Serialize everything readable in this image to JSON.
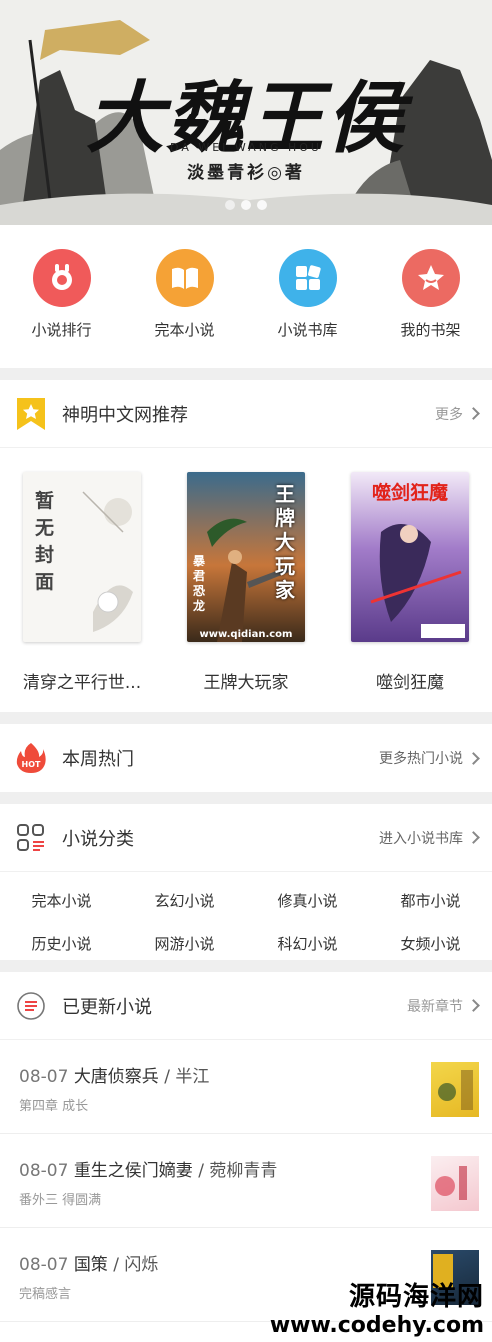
{
  "banner": {
    "title": "大魏王侯",
    "pinyin": "DA WEI WANG HOU",
    "author": "淡墨青衫◎著",
    "slides": 3,
    "active_slide": 1
  },
  "quicknav": [
    {
      "label": "小说排行",
      "icon": "ranking-icon",
      "color": "#f05a5a"
    },
    {
      "label": "完本小说",
      "icon": "book-open-icon",
      "color": "#f5a236"
    },
    {
      "label": "小说书库",
      "icon": "library-grid-icon",
      "color": "#3fb2ea"
    },
    {
      "label": "我的书架",
      "icon": "star-shelf-icon",
      "color": "#ec6a62"
    }
  ],
  "recommend": {
    "title": "神明中文网推荐",
    "more": "更多",
    "books": [
      {
        "title": "清穿之平行世...",
        "cover_text": "暂无封面"
      },
      {
        "title": "王牌大玩家",
        "cover_text": "王牌大玩家",
        "cover_author": "暴君恐龙",
        "cover_site": "www.qidian.com"
      },
      {
        "title": "噬剑狂魔",
        "cover_text": "噬剑狂魔"
      }
    ]
  },
  "hot": {
    "title": "本周热门",
    "badge": "HOT",
    "more": "更多热门小说"
  },
  "categories": {
    "title": "小说分类",
    "more": "进入小说书库",
    "items": [
      "完本小说",
      "玄幻小说",
      "修真小说",
      "都市小说",
      "历史小说",
      "网游小说",
      "科幻小说",
      "女频小说"
    ]
  },
  "updates": {
    "title": "已更新小说",
    "more": "最新章节",
    "items": [
      {
        "date": "08-07",
        "title": "大唐侦察兵",
        "author": "半江",
        "chapter": "第四章 成长"
      },
      {
        "date": "08-07",
        "title": "重生之侯门嫡妻",
        "author": "菀柳青青",
        "chapter": "番外三 得圆满"
      },
      {
        "date": "08-07",
        "title": "国策",
        "author": "闪烁",
        "chapter": "完稿感言"
      }
    ]
  },
  "watermark": {
    "line1": "源码海洋网",
    "line2": "www.codehy.com"
  }
}
